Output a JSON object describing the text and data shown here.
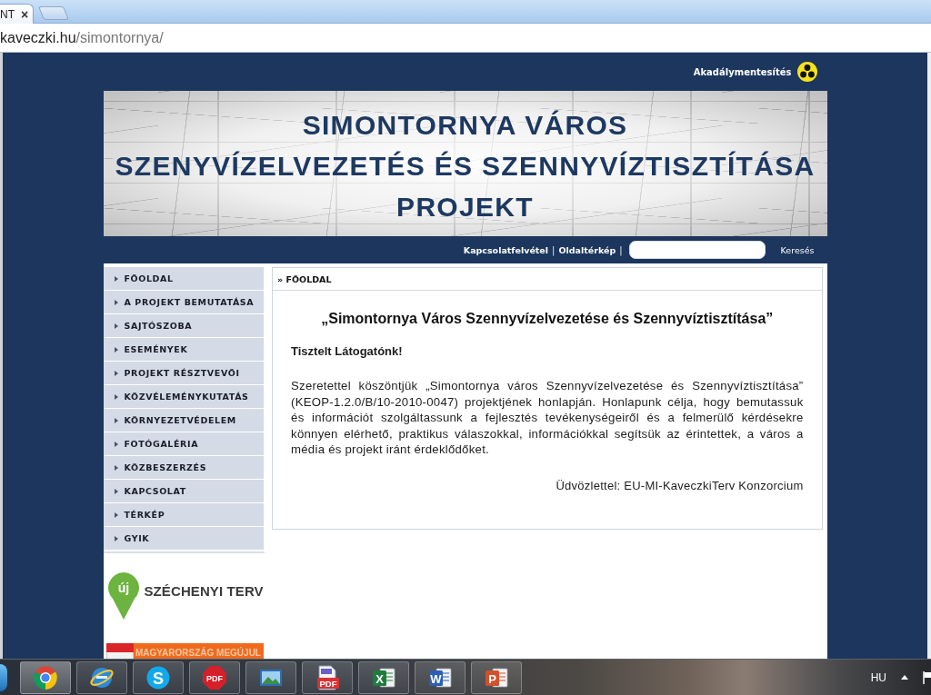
{
  "browser": {
    "tabs": [
      {
        "label": "NT",
        "close": "×",
        "selected": true
      }
    ],
    "address": {
      "host": "kaveczki.hu",
      "path": "/simontornya/"
    }
  },
  "header": {
    "accessibility_link": "Akadálymentesítés",
    "banner_title": [
      "SIMONTORNYA VÁROS",
      "SZENYVÍZELVEZETÉS ÉS SZENNYVÍZTISZTÍTÁSA",
      "PROJEKT"
    ],
    "links": [
      {
        "kind": "link",
        "text": "Kapcsolatfelvétel"
      },
      {
        "kind": "separator",
        "text": "|"
      },
      {
        "kind": "link",
        "text": "Oldaltérkép"
      },
      {
        "kind": "separator",
        "text": "|"
      }
    ],
    "search": {
      "button": "Keresés"
    }
  },
  "sidebar": {
    "menu": [
      {
        "label": "FŐOLDAL"
      },
      {
        "label": "A PROJEKT BEMUTATÁSA"
      },
      {
        "label": "SAJTÓSZOBA"
      },
      {
        "label": "ESEMÉNYEK"
      },
      {
        "label": "PROJEKT RÉSZTVEVŐI"
      },
      {
        "label": "KÖZVÉLEMÉNYKUTATÁS"
      },
      {
        "label": "KÖRNYEZETVÉDELEM"
      },
      {
        "label": "FOTÓGALÉRIA"
      },
      {
        "label": "KÖZBESZERZÉS"
      },
      {
        "label": "KAPCSOLAT"
      },
      {
        "label": "TÉRKÉP"
      },
      {
        "label": "GYIK"
      }
    ],
    "logos": [
      {
        "kind": "pin",
        "mark": "új",
        "text": "SZÉCHENYI TERV"
      },
      {
        "kind": "flag-banner",
        "text": "MAGYARORSZÁG MEGÚJUL"
      }
    ]
  },
  "content": {
    "breadcrumb": "» FŐOLDAL",
    "title": "„Simontornya Város Szennyvízelvezetése és Szennyvíztisztítása”",
    "greeting": "Tisztelt Látogatónk!",
    "body": "Szeretettel köszöntjük „Simontornya város Szennyvízelvezetése és Szennyvíztisztítása” (KEOP-1.2.0/B/10-2010-0047) projektjének honlapján. Honlapunk célja, hogy bemutassuk és információt szolgáltassunk a fejlesztés tevékenységeiről és a felmerülő kérdésekre könnyen elérhető, praktikus válaszokkal, információkkal segítsük az érintettek, a város a média és projekt iránt érdeklődőket.",
    "signature": "Üdvözlettel: EU-MI-KaveczkiTerv Konzorcium"
  },
  "taskbar": {
    "apps": [
      {
        "kind": "ring",
        "selected": true
      },
      {
        "kind": "globe",
        "selected": false
      },
      {
        "kind": "s-logo",
        "glyph": "S",
        "selected": false
      },
      {
        "kind": "pdf-logo",
        "glyph": "PDF",
        "selected": false
      },
      {
        "kind": "picture",
        "selected": false
      },
      {
        "kind": "document",
        "glyph": "PDF",
        "selected": false
      },
      {
        "kind": "x-logo",
        "glyph": "X",
        "selected": false
      },
      {
        "kind": "w-logo",
        "glyph": "W",
        "selected": false
      },
      {
        "kind": "p-logo",
        "glyph": "P",
        "selected": false
      }
    ],
    "language": "HU"
  }
}
